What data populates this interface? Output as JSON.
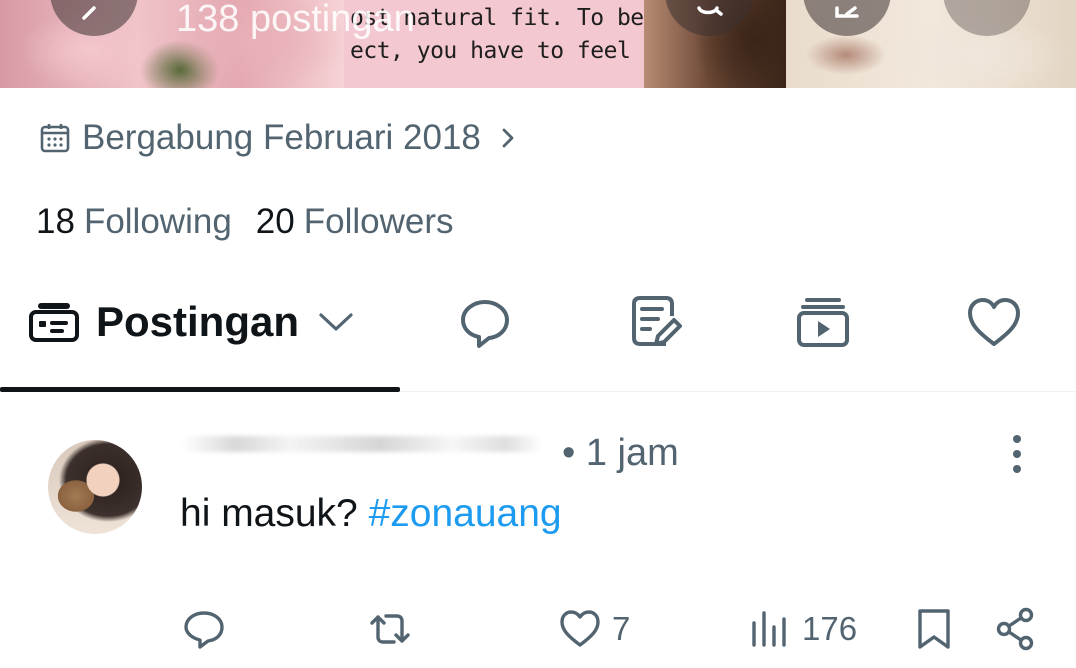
{
  "header": {
    "post_count": "138 postingan",
    "quote_lines": [
      "ost natural fit. To be per",
      "ect, you have to feel per-",
      "        ."
    ]
  },
  "profile": {
    "joined": "Bergabung Februari 2018",
    "following_count": "18",
    "following_label": "Following",
    "followers_count": "20",
    "followers_label": "Followers"
  },
  "tabs": {
    "active_label": "Postingan",
    "icons": [
      "replies-icon",
      "articles-icon",
      "media-icon",
      "likes-icon"
    ]
  },
  "post": {
    "time": "• 1 jam",
    "text": "hi masuk?",
    "hashtag": "#zonauang",
    "likes": "7",
    "views": "176"
  },
  "colors": {
    "text_primary": "#0f1419",
    "text_secondary": "#536471",
    "link": "#1d9bf0",
    "divider": "#eff3f4"
  }
}
